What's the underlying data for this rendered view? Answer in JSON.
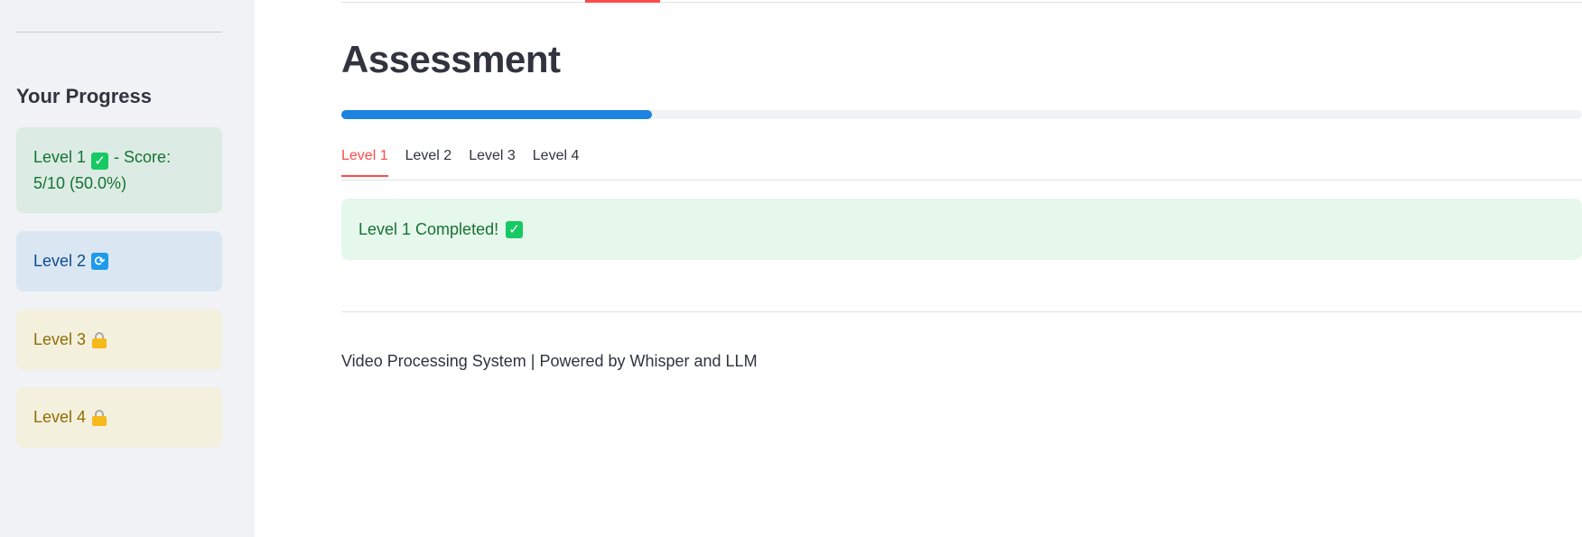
{
  "sidebar": {
    "heading": "Your Progress",
    "levels": [
      {
        "label": "Level 1",
        "status_icon": "check-mark-icon",
        "detail": "- Score: 5/10 (50.0%)",
        "state": "completed"
      },
      {
        "label": "Level 2",
        "status_icon": "refresh-icon",
        "detail": "",
        "state": "in-progress"
      },
      {
        "label": "Level 3",
        "status_icon": "lock-icon",
        "detail": "",
        "state": "locked"
      },
      {
        "label": "Level 4",
        "status_icon": "lock-icon",
        "detail": "",
        "state": "locked"
      }
    ]
  },
  "main": {
    "title": "Assessment",
    "progress": {
      "value": 0.25
    },
    "tabs": [
      {
        "label": "Level 1",
        "active": true
      },
      {
        "label": "Level 2",
        "active": false
      },
      {
        "label": "Level 3",
        "active": false
      },
      {
        "label": "Level 4",
        "active": false
      }
    ],
    "alert": {
      "text": "Level 1 Completed!"
    },
    "footer": "Video Processing System | Powered by Whisper and LLM"
  },
  "colors": {
    "accent": "#ff4b4b",
    "progress": "#1c83e1",
    "success_bg": "#dcece4",
    "info_bg": "#dbe6f3",
    "warning_bg": "#f3f1de"
  }
}
